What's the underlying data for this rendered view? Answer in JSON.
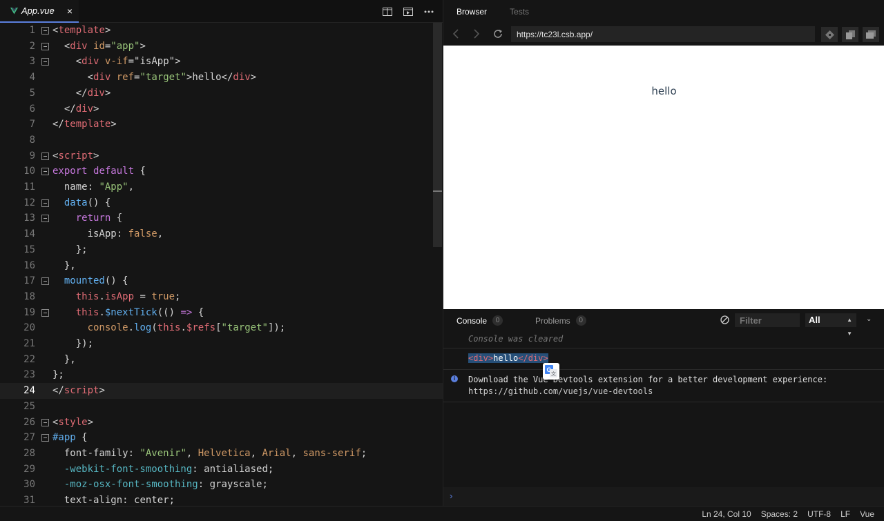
{
  "editor": {
    "file_tab": "App.vue",
    "close_glyph": "×",
    "actions": [
      "split-view-icon",
      "preview-icon",
      "more-icon"
    ],
    "current_line": 24,
    "lines": [
      {
        "n": 1,
        "fold": true,
        "html": "<span class=\"tp\">&lt;</span><span class=\"tg\">template</span><span class=\"tp\">&gt;</span>"
      },
      {
        "n": 2,
        "fold": true,
        "html": "  <span class=\"tp\">&lt;</span><span class=\"tg\">div</span> <span class=\"at\">id</span><span class=\"tp\">=</span><span class=\"st\">\"app\"</span><span class=\"tp\">&gt;</span>"
      },
      {
        "n": 3,
        "fold": true,
        "html": "    <span class=\"tp\">&lt;</span><span class=\"tg\">div</span> <span class=\"at\">v-if</span><span class=\"tp\">=</span><span class=\"tx\">\"isApp\"</span><span class=\"tp\">&gt;</span>"
      },
      {
        "n": 4,
        "fold": false,
        "html": "      <span class=\"tp\">&lt;</span><span class=\"tg\">div</span> <span class=\"at\">ref</span><span class=\"tp\">=</span><span class=\"st\">\"target\"</span><span class=\"tp\">&gt;</span>hello<span class=\"tp\">&lt;/</span><span class=\"tg\">div</span><span class=\"tp\">&gt;</span>"
      },
      {
        "n": 5,
        "fold": false,
        "html": "    <span class=\"tp\">&lt;/</span><span class=\"tg\">div</span><span class=\"tp\">&gt;</span>"
      },
      {
        "n": 6,
        "fold": false,
        "html": "  <span class=\"tp\">&lt;/</span><span class=\"tg\">div</span><span class=\"tp\">&gt;</span>"
      },
      {
        "n": 7,
        "fold": false,
        "html": "<span class=\"tp\">&lt;/</span><span class=\"tg\">template</span><span class=\"tp\">&gt;</span>"
      },
      {
        "n": 8,
        "fold": false,
        "html": ""
      },
      {
        "n": 9,
        "fold": true,
        "html": "<span class=\"tp\">&lt;</span><span class=\"tg\">script</span><span class=\"tp\">&gt;</span>"
      },
      {
        "n": 10,
        "fold": true,
        "html": "<span class=\"kw\">export</span> <span class=\"kw\">default</span> {"
      },
      {
        "n": 11,
        "fold": false,
        "html": "  name: <span class=\"st\">\"App\"</span>,"
      },
      {
        "n": 12,
        "fold": true,
        "html": "  <span class=\"fn\">data</span>() {"
      },
      {
        "n": 13,
        "fold": true,
        "html": "    <span class=\"kw\">return</span> {"
      },
      {
        "n": 14,
        "fold": false,
        "html": "      isApp: <span class=\"nm\">false</span>,"
      },
      {
        "n": 15,
        "fold": false,
        "html": "    };"
      },
      {
        "n": 16,
        "fold": false,
        "html": "  },"
      },
      {
        "n": 17,
        "fold": true,
        "html": "  <span class=\"fn\">mounted</span>() {"
      },
      {
        "n": 18,
        "fold": false,
        "html": "    <span class=\"tg\">this</span>.<span class=\"tg\">isApp</span> = <span class=\"nm\">true</span>;"
      },
      {
        "n": 19,
        "fold": true,
        "html": "    <span class=\"tg\">this</span>.<span class=\"fn\">$nextTick</span>(() <span class=\"kw\">=&gt;</span> {"
      },
      {
        "n": 20,
        "fold": false,
        "html": "      <span class=\"nm\">console</span>.<span class=\"fn\">log</span>(<span class=\"tg\">this</span>.<span class=\"tg\">$refs</span>[<span class=\"st\">\"target\"</span>]);"
      },
      {
        "n": 21,
        "fold": false,
        "html": "    });"
      },
      {
        "n": 22,
        "fold": false,
        "html": "  },"
      },
      {
        "n": 23,
        "fold": false,
        "html": "};"
      },
      {
        "n": 24,
        "fold": false,
        "html": "<span class=\"tp\">&lt;/</span><span class=\"tg\">script</span><span class=\"tp\">&gt;</span>"
      },
      {
        "n": 25,
        "fold": false,
        "html": ""
      },
      {
        "n": 26,
        "fold": true,
        "html": "<span class=\"tp\">&lt;</span><span class=\"tg\">style</span><span class=\"tp\">&gt;</span>"
      },
      {
        "n": 27,
        "fold": true,
        "html": "<span class=\"fn\">#app</span> {"
      },
      {
        "n": 28,
        "fold": false,
        "html": "  <span class=\"tx\">font-family</span>: <span class=\"st\">\"Avenir\"</span>, <span class=\"nm\">Helvetica</span>, <span class=\"nm\">Arial</span>, <span class=\"nm\">sans-serif</span>;"
      },
      {
        "n": 29,
        "fold": false,
        "html": "  <span class=\"pr\">-webkit-font-smoothing</span>: antialiased;"
      },
      {
        "n": 30,
        "fold": false,
        "html": "  <span class=\"pr\">-moz-osx-font-smoothing</span>: grayscale;"
      },
      {
        "n": 31,
        "fold": false,
        "html": "  <span class=\"tx\">text-align</span>: center;"
      }
    ]
  },
  "preview": {
    "tabs": [
      {
        "label": "Browser",
        "active": true
      },
      {
        "label": "Tests",
        "active": false
      }
    ],
    "url": "https://tc23l.csb.app/",
    "content_text": "hello"
  },
  "console": {
    "tab_console": "Console",
    "console_count": "0",
    "tab_problems": "Problems",
    "problems_count": "0",
    "filter_placeholder": "Filter",
    "level": "All",
    "cleared": "Console was cleared",
    "log_open": "<div>",
    "log_text": "hello",
    "log_close": "</div>",
    "info_line1": "Download the Vue Devtools extension for a better development experience:",
    "info_line2": "https://github.com/vuejs/vue-devtools",
    "prompt": "›"
  },
  "status": {
    "cursor": "Ln 24, Col 10",
    "spaces": "Spaces: 2",
    "encoding": "UTF-8",
    "eol": "LF",
    "language": "Vue"
  },
  "colors": {
    "accent": "#5b7fde",
    "background": "#151515",
    "preview_bg": "#ffffff",
    "hello": "#2c3e50"
  }
}
